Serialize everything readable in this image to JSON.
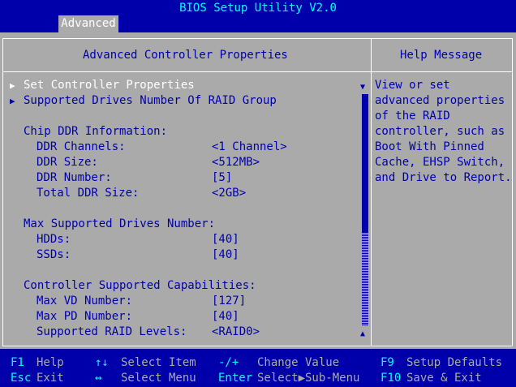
{
  "title": "BIOS Setup Utility V2.0",
  "tab": "Advanced",
  "panel": {
    "title": "Advanced Controller Properties",
    "help_title": "Help Message"
  },
  "menu": [
    {
      "marker": "▶",
      "label": "Set Controller Properties"
    },
    {
      "marker": "▶",
      "label": "Supported Drives Number Of RAID Group"
    }
  ],
  "sections": [
    {
      "heading": "Chip DDR Information:",
      "rows": [
        {
          "label": "DDR Channels:",
          "value": "<1 Channel>"
        },
        {
          "label": "DDR Size:",
          "value": "<512MB>"
        },
        {
          "label": "DDR Number:",
          "value": "[5]"
        },
        {
          "label": "Total DDR Size:",
          "value": "<2GB>"
        }
      ]
    },
    {
      "heading": "Max Supported Drives Number:",
      "rows": [
        {
          "label": "HDDs:",
          "value": "[40]"
        },
        {
          "label": "SSDs:",
          "value": "[40]"
        }
      ]
    },
    {
      "heading": "Controller Supported Capabilities:",
      "rows": [
        {
          "label": "Max VD Number:",
          "value": "[127]"
        },
        {
          "label": "Max PD Number:",
          "value": "[40]"
        },
        {
          "label": "Supported RAID Levels:",
          "value": "<RAID0>"
        }
      ]
    }
  ],
  "help_lines": [
    "View or set",
    "advanced properties",
    "of the RAID",
    "controller, such as",
    "Boot With Pinned",
    "Cache, EHSP Switch,",
    "and Drive to Report."
  ],
  "scroll": {
    "up_arrow": "▲",
    "down_arrow": "▼"
  },
  "footer": [
    {
      "key": "F1",
      "desc": "Help"
    },
    {
      "key": "↑↓",
      "desc": "Select Item"
    },
    {
      "key": "-/+",
      "desc": "Change Value"
    },
    {
      "key": "F9",
      "desc": "Setup Defaults"
    },
    {
      "key": "Esc",
      "desc": "Exit"
    },
    {
      "key": "↔",
      "desc": "Select Menu"
    },
    {
      "key": "Enter",
      "desc": "Select▶Sub-Menu"
    },
    {
      "key": "F10",
      "desc": "Save & Exit"
    }
  ],
  "colors": {
    "background": "#0000aa",
    "panel": "#aaaaaa",
    "title": "#00ffff",
    "highlight": "#ffffff"
  }
}
